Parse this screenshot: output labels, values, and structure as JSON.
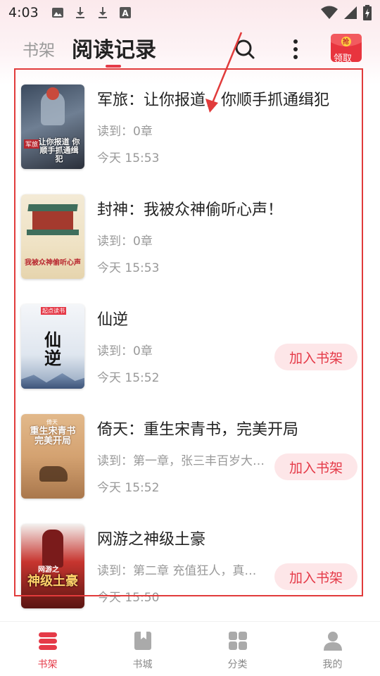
{
  "status_bar": {
    "time": "4:03",
    "icons": [
      "image-icon",
      "download-icon",
      "download-icon",
      "font-app-icon"
    ],
    "right_icons": [
      "wifi-icon",
      "signal-icon",
      "battery-charging-icon"
    ]
  },
  "header": {
    "tab_shelf": "书架",
    "tab_history": "阅读记录",
    "reward_label": "领取",
    "reward_badge": "抢"
  },
  "books": [
    {
      "title": "军旅：让你报道，你顺手抓通缉犯",
      "progress": "读到：0章",
      "time": "今天 15:53",
      "cover_text": "让你报道 你顺手抓通缉犯",
      "cover_tag": "军旅",
      "add_label": ""
    },
    {
      "title": "封神：我被众神偷听心声！",
      "progress": "读到：0章",
      "time": "今天 15:53",
      "cover_text": "我被众神偷听心声",
      "cover_tag": "",
      "add_label": ""
    },
    {
      "title": "仙逆",
      "progress": "读到：0章",
      "time": "今天 15:52",
      "cover_text": "仙逆",
      "cover_tag": "起点读书",
      "add_label": "加入书架"
    },
    {
      "title": "倚天：重生宋青书，完美开局",
      "progress": "读到：第一章，张三丰百岁大…",
      "time": "今天 15:52",
      "cover_text": "重生宋青书 完美开局",
      "cover_tag": "倚天",
      "add_label": "加入书架"
    },
    {
      "title": "网游之神级土豪",
      "progress": "读到：第二章 充值狂人，真…",
      "time": "今天 15:50",
      "cover_text": "神级土豪",
      "cover_tag": "网游之",
      "add_label": "加入书架"
    }
  ],
  "bottom_nav": [
    {
      "label": "书架",
      "icon": "bookshelf-icon",
      "active": true
    },
    {
      "label": "书城",
      "icon": "book-store-icon",
      "active": false
    },
    {
      "label": "分类",
      "icon": "category-grid-icon",
      "active": false
    },
    {
      "label": "我的",
      "icon": "profile-icon",
      "active": false
    }
  ],
  "colors": {
    "accent": "#e53a48",
    "annotation": "#e13b3b",
    "muted_text": "#999999"
  }
}
